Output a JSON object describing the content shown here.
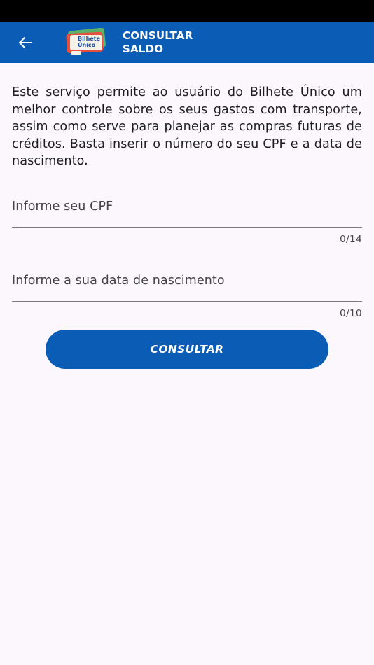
{
  "header": {
    "title_line1": "CONSULTAR",
    "title_line2": "SALDO",
    "logo_text_line1": "Bilhete",
    "logo_text_line2": "Único",
    "back_icon": "arrow-left-icon"
  },
  "main": {
    "description": "Este serviço permite ao usuário do Bilhete Único um melhor controle sobre os seus gastos com transporte, assim como serve para planejar as compras futuras de créditos. Basta inserir o número do seu CPF e a data de nascimento.",
    "cpf_field": {
      "label": "Informe seu CPF",
      "value": "",
      "counter": "0/14"
    },
    "birth_field": {
      "label": "Informe a sua data de nascimento",
      "value": "",
      "counter": "0/10"
    },
    "submit_label": "CONSULTAR"
  },
  "colors": {
    "primary": "#0b5cb5",
    "background": "#fcf7fc",
    "text": "#1e1e22"
  }
}
